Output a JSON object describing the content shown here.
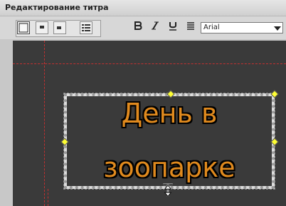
{
  "window": {
    "title": "Редактирование титра"
  },
  "toolbar": {
    "font_select": {
      "value": "Arial"
    }
  },
  "title": {
    "line1": "День в",
    "line2": "зоопарке"
  },
  "colors": {
    "text": "#e08a1e",
    "outline": "#000000",
    "background": "#3a3a3a",
    "guide": "#c23030",
    "handle": "#ffff33"
  },
  "icons": [
    "box-style-icon",
    "align-top-icon",
    "align-left-icon",
    "list-icon",
    "bold-icon",
    "italic-icon",
    "underline-icon",
    "justify-icon",
    "resize-vertical-cursor-icon"
  ]
}
